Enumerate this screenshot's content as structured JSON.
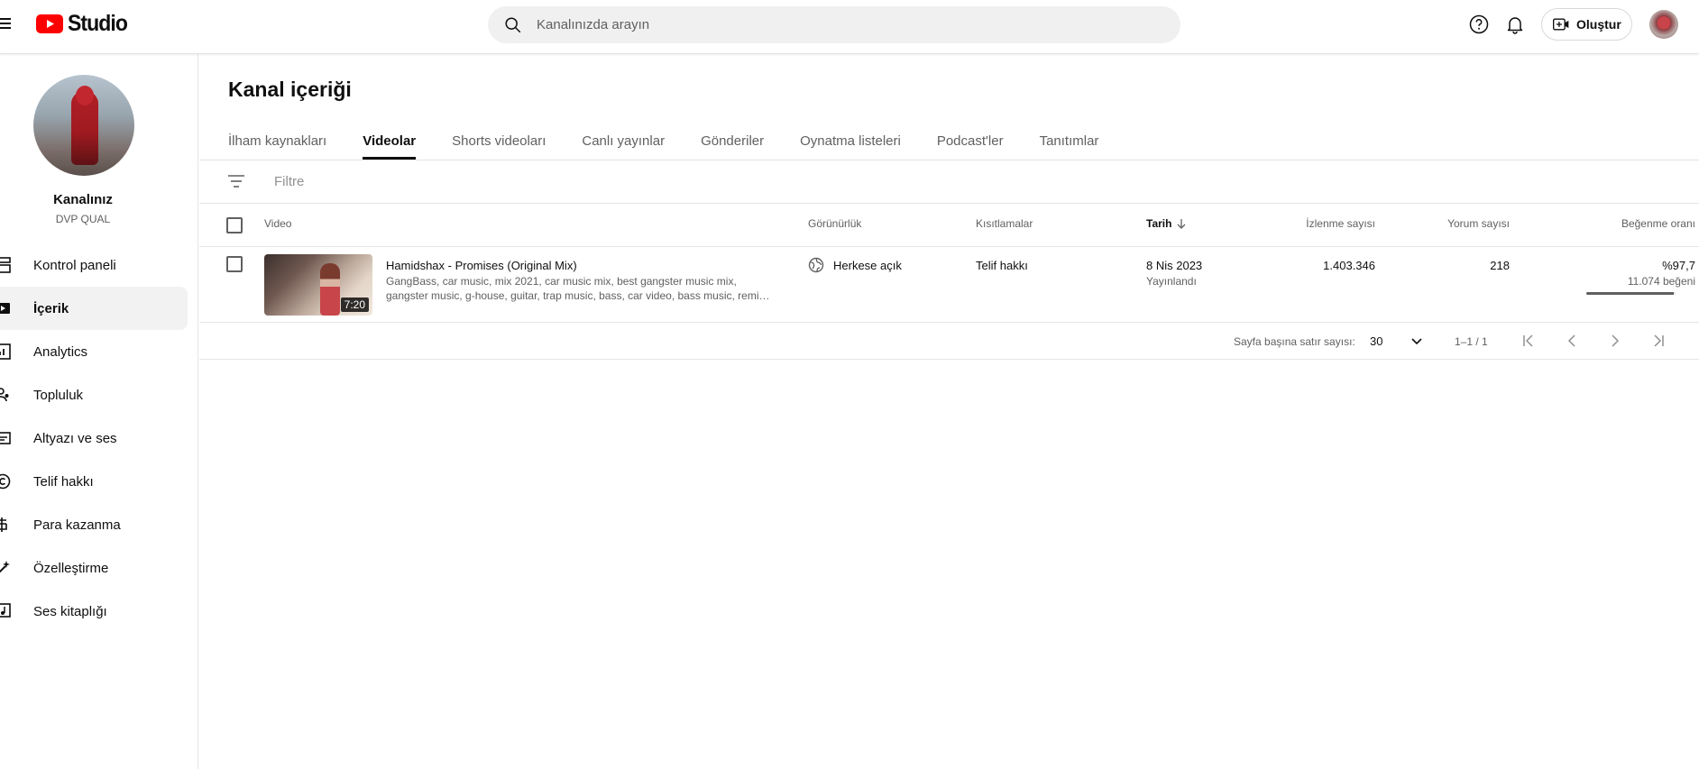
{
  "header": {
    "logo_text": "Studio",
    "search_placeholder": "Kanalınızda arayın",
    "create_label": "Oluştur"
  },
  "sidebar": {
    "channel_name": "Kanalınız",
    "channel_handle": "DVP QUAL",
    "items": [
      {
        "label": "Kontrol paneli",
        "icon": "dashboard-icon"
      },
      {
        "label": "İçerik",
        "icon": "content-icon",
        "active": true
      },
      {
        "label": "Analytics",
        "icon": "analytics-icon"
      },
      {
        "label": "Topluluk",
        "icon": "community-icon"
      },
      {
        "label": "Altyazı ve ses",
        "icon": "subtitles-icon"
      },
      {
        "label": "Telif hakkı",
        "icon": "copyright-icon"
      },
      {
        "label": "Para kazanma",
        "icon": "monetization-icon"
      },
      {
        "label": "Özelleştirme",
        "icon": "customization-icon"
      },
      {
        "label": "Ses kitaplığı",
        "icon": "audio-library-icon"
      }
    ]
  },
  "main": {
    "title": "Kanal içeriği",
    "tabs": [
      {
        "label": "İlham kaynakları"
      },
      {
        "label": "Videolar",
        "active": true
      },
      {
        "label": "Shorts videoları"
      },
      {
        "label": "Canlı yayınlar"
      },
      {
        "label": "Gönderiler"
      },
      {
        "label": "Oynatma listeleri"
      },
      {
        "label": "Podcast'ler"
      },
      {
        "label": "Tanıtımlar"
      }
    ],
    "filter_placeholder": "Filtre",
    "columns": {
      "video": "Video",
      "visibility": "Görünürlük",
      "restrictions": "Kısıtlamalar",
      "date": "Tarih",
      "views": "İzlenme sayısı",
      "comments": "Yorum sayısı",
      "likes": "Beğenme oranı"
    },
    "rows": [
      {
        "title": "Hamidshax - Promises (Original Mix)",
        "description": "GangBass, car music, mix 2021, car music mix, best gangster music mix, gangster music, g-house, guitar, trap music, bass, car video, bass music, remi…",
        "duration": "7:20",
        "visibility": "Herkese açık",
        "restrictions": "Telif hakkı",
        "date": "8 Nis 2023",
        "date_status": "Yayınlandı",
        "views": "1.403.346",
        "comments": "218",
        "like_ratio": "%97,7",
        "like_ratio_value": 0.977,
        "likes_count": "11.074 beğeni"
      }
    ],
    "pagination": {
      "rows_label": "Sayfa başına satır sayısı:",
      "rows_value": "30",
      "range": "1–1 / 1"
    }
  },
  "colors": {
    "brand_red": "#ff0000",
    "text_primary": "#0f0f0f",
    "text_secondary": "#606060"
  }
}
